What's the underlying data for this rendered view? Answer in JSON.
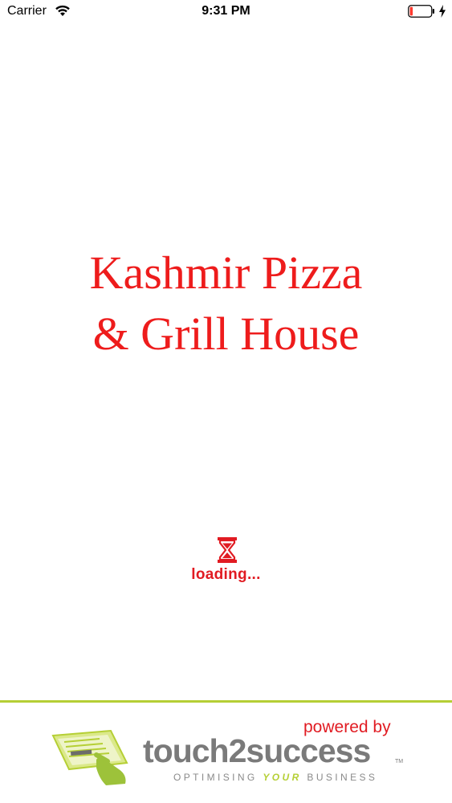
{
  "status_bar": {
    "carrier": "Carrier",
    "time": "9:31 PM",
    "icons": [
      "wifi-icon",
      "battery-icon",
      "charging-icon"
    ]
  },
  "splash": {
    "title_line1": "Kashmir Pizza",
    "title_line2": "& Grill House",
    "loading_text": "loading...",
    "loading_icon": "hourglass-icon"
  },
  "footer": {
    "powered_by": "powered by",
    "brand": "touch2success",
    "trademark": "TM",
    "tagline_part1": "OPTIMISING ",
    "tagline_accent": "YOUR",
    "tagline_part2": " BUSINESS",
    "logo_icon": "touch2success-logo-icon"
  },
  "colors": {
    "title": "#ee1c1c",
    "loading": "#e11b22",
    "footer_rule": "#b5cf35",
    "brand_gray": "#7a7a7a"
  }
}
